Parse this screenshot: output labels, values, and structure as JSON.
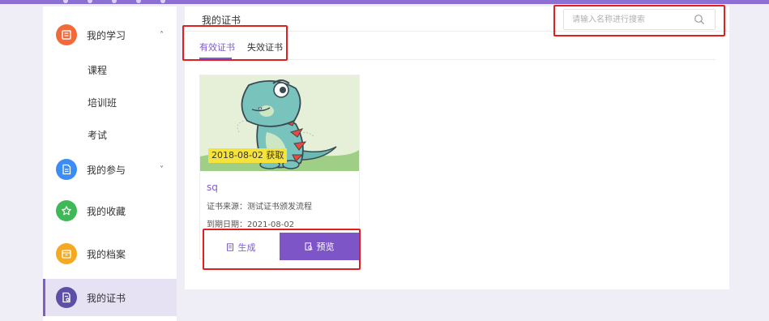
{
  "sidebar": {
    "items": [
      {
        "label": "我的学习",
        "icon": "book-icon",
        "color": "#f26a39",
        "chevron": "up"
      },
      {
        "label": "我的参与",
        "icon": "document-icon",
        "color": "#3b8cf5",
        "chevron": "down"
      },
      {
        "label": "我的收藏",
        "icon": "star-icon",
        "color": "#3fb957"
      },
      {
        "label": "我的档案",
        "icon": "archive-icon",
        "color": "#f5a923"
      },
      {
        "label": "我的证书",
        "icon": "certificate-icon",
        "color": "#5d4fa6",
        "active": true
      }
    ],
    "sub_items": [
      "课程",
      "培训班",
      "考试"
    ]
  },
  "main": {
    "title": "我的证书",
    "search_placeholder": "请输入名称进行搜索",
    "tabs": [
      {
        "label": "有效证书",
        "active": true
      },
      {
        "label": "失效证书",
        "active": false
      }
    ]
  },
  "certificate": {
    "badge": "2018-08-02 获取",
    "name": "sq",
    "source": "证书来源：测试证书颁发流程",
    "expiry": "到期日期：2021-08-02",
    "generate_label": "生成",
    "preview_label": "预览"
  },
  "colors": {
    "accent": "#7d5ccc",
    "annotation": "#e02020",
    "badge": "#f5e23a"
  }
}
